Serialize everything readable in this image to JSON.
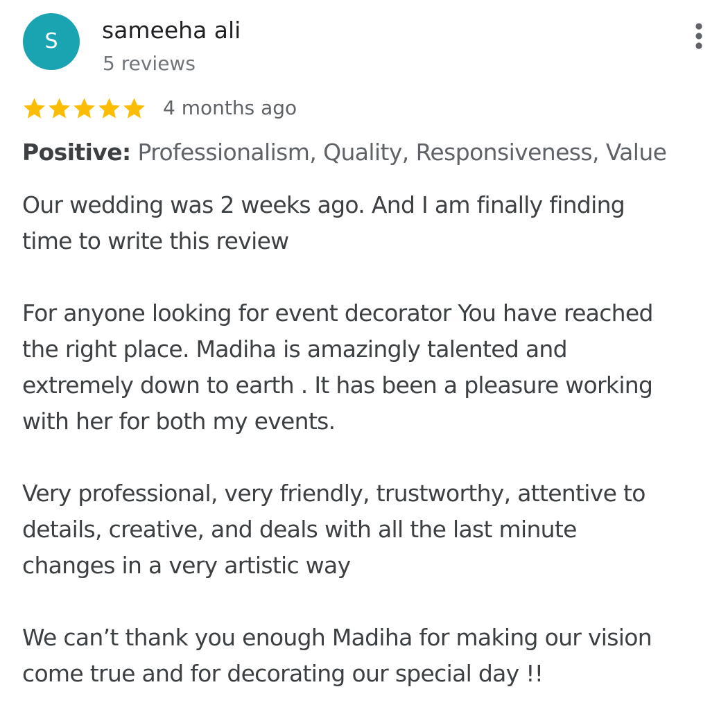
{
  "review": {
    "author": {
      "initial": "S",
      "name": "sameeha ali",
      "review_count": "5 reviews",
      "avatar_color": "#1aa4b2"
    },
    "menu_icon": "more-vert-icon",
    "rating": {
      "stars": 5,
      "max": 5,
      "star_color": "#fbbc04",
      "star_icon": "star-icon"
    },
    "time_ago": "4 months ago",
    "attributes": {
      "label": "Positive:",
      "values": "Professionalism, Quality, Responsiveness, Value"
    },
    "paragraphs": [
      {
        "lines": [
          "Our wedding was 2 weeks ago. And I am finally finding",
          "time to write this review"
        ]
      },
      {
        "lines": [
          "For anyone looking for event decorator You have reached",
          "the right place. Madiha is amazingly talented and",
          "extremely down to earth . It has been a pleasure working",
          "with her for both my events."
        ]
      },
      {
        "lines": [
          "Very professional, very friendly, trustworthy, attentive to",
          "details, creative, and deals with all the last minute",
          "changes in a very artistic way"
        ]
      },
      {
        "lines": [
          "We can’t thank you enough Madiha for making our vision",
          "come true and for decorating our special day !!"
        ]
      }
    ]
  }
}
